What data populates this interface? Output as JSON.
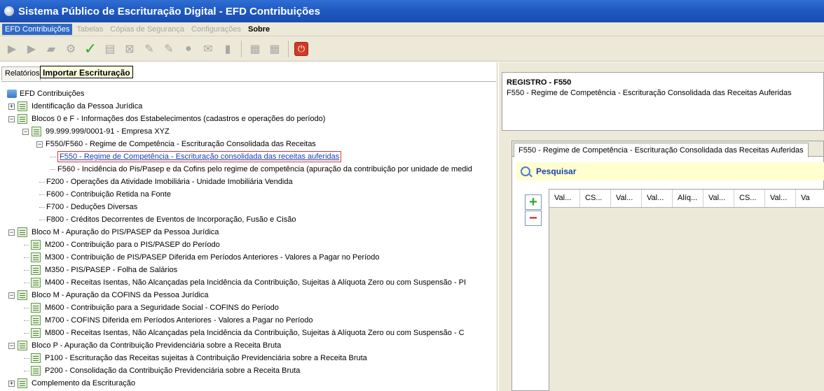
{
  "window": {
    "title": "Sistema Público de Escrituração Digital - EFD Contribuições"
  },
  "menu": [
    {
      "label": "EFD Contribuições",
      "state": "active"
    },
    {
      "label": "Tabelas",
      "state": "disabled"
    },
    {
      "label": "Cópias de Segurança",
      "state": "disabled"
    },
    {
      "label": "Configurações",
      "state": "disabled"
    },
    {
      "label": "Sobre",
      "state": "bold"
    }
  ],
  "toolbar_icons": [
    "new-icon",
    "import-icon",
    "open-icon",
    "validate-icon",
    "check-icon",
    "print-icon",
    "close-file-icon",
    "sign-icon",
    "transmit-icon",
    "receipt-icon",
    "mail-icon",
    "delete-icon",
    "save-icon",
    "save-as-icon",
    "power-icon"
  ],
  "left": {
    "tab_label": "Relatórios",
    "tooltip": "Importar Escrituração"
  },
  "tree": [
    {
      "label": "EFD Contribuições"
    },
    {
      "label": "Identificação da Pessoa Jurídica"
    },
    {
      "label": "Blocos 0 e F - Informações dos Estabelecimentos (cadastros e operações do período)"
    },
    {
      "label": "99.999.999/0001-91  -  Empresa XYZ"
    },
    {
      "label": "F550/F560 - Regime de Competência - Escrituração Consolidada das Receitas"
    },
    {
      "label": "F550 - Regime de Competência - Escrituração consolidada das receitas auferidas"
    },
    {
      "label": "F560 - Incidência do Pis/Pasep e da Cofins pelo regime de competência (apuração da contribuição por unidade de medid"
    },
    {
      "label": "F200 - Operações da Atividade Imobiliária - Unidade Imobiliária Vendida"
    },
    {
      "label": "F600 - Contribuição Retida na Fonte"
    },
    {
      "label": "F700 - Deduções Diversas"
    },
    {
      "label": "F800 - Créditos Decorrentes de Eventos de Incorporação, Fusão e Cisão"
    },
    {
      "label": "Bloco M - Apuração do PIS/PASEP da Pessoa Jurídica"
    },
    {
      "label": "M200 - Contribuição para o PIS/PASEP do Período"
    },
    {
      "label": "M300 - Contribuição de PIS/PASEP Diferida em Períodos Anteriores - Valores a Pagar no Período"
    },
    {
      "label": "M350 - PIS/PASEP - Folha de Salários"
    },
    {
      "label": "M400 - Receitas Isentas, Não Alcançadas pela Incidência da Contribuição, Sujeitas à Alíquota Zero ou com Suspensão - PI"
    },
    {
      "label": "Bloco M - Apuração da COFINS da Pessoa Jurídica"
    },
    {
      "label": "M600 - Contribuição para a Seguridade Social - COFINS do Período"
    },
    {
      "label": "M700 - COFINS Diferida em Períodos Anteriores - Valores a Pagar no Período"
    },
    {
      "label": "M800 - Receitas Isentas, Não Alcançadas pela Incidência da Contribuição, Sujeitas à Alíquota Zero ou com Suspensão - C"
    },
    {
      "label": "Bloco P - Apuração da Contribuição Previdenciária sobre a Receita Bruta"
    },
    {
      "label": "P100 - Escrituração das Receitas sujeitas à Contribuição Previdenciária sobre a Receita Bruta"
    },
    {
      "label": "P200 - Consolidação da Contribuição Previdenciária sobre a Receita Bruta"
    },
    {
      "label": "Complemento da Escrituração"
    }
  ],
  "right": {
    "register_title": "REGISTRO - F550",
    "register_desc": "F550 - Regime de Competência - Escrituração Consolidada das Receitas Auferidas",
    "tab_label": "F550 - Regime de Competência - Escrituração Consolidada das Receitas Auferidas",
    "search_label": "Pesquisar",
    "add_symbol": "+",
    "remove_symbol": "−",
    "columns": [
      "Val...",
      "CS...",
      "Val...",
      "Val...",
      "Alíq...",
      "Val...",
      "CS...",
      "Val...",
      "Va"
    ]
  }
}
